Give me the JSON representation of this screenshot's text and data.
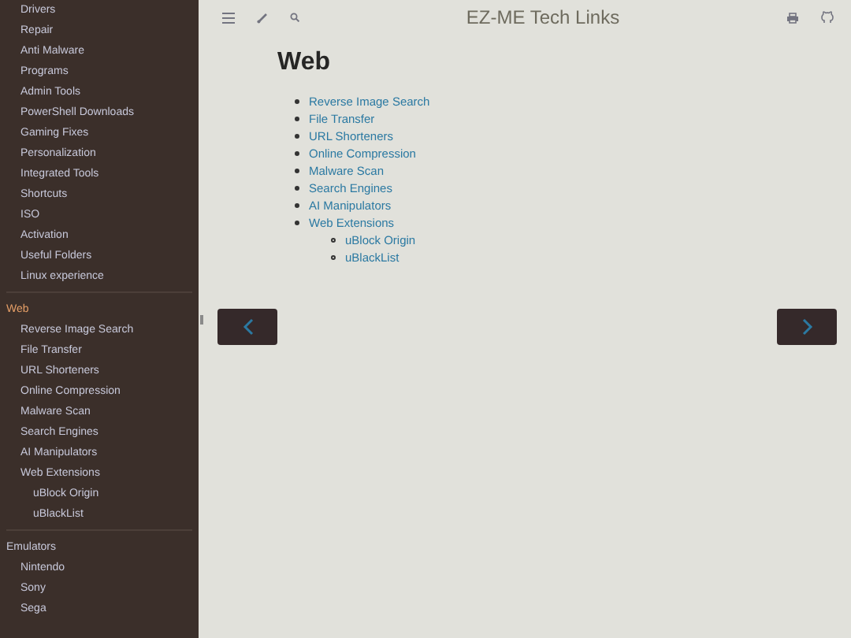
{
  "sidebar": {
    "sections": [
      {
        "items": [
          {
            "label": "Drivers",
            "selected": false
          },
          {
            "label": "Repair",
            "selected": false
          },
          {
            "label": "Anti Malware",
            "selected": false
          },
          {
            "label": "Programs",
            "selected": false
          },
          {
            "label": "Admin Tools",
            "selected": false
          },
          {
            "label": "PowerShell Downloads",
            "selected": false
          },
          {
            "label": "Gaming Fixes",
            "selected": false
          },
          {
            "label": "Personalization",
            "selected": false
          },
          {
            "label": "Integrated Tools",
            "selected": false
          },
          {
            "label": "Shortcuts",
            "selected": false
          },
          {
            "label": "ISO",
            "selected": false
          },
          {
            "label": "Activation",
            "selected": false
          },
          {
            "label": "Useful Folders",
            "selected": false
          },
          {
            "label": "Linux experience",
            "selected": false
          }
        ]
      },
      {
        "title": "Web",
        "selected": true,
        "items": [
          {
            "label": "Reverse Image Search",
            "selected": false
          },
          {
            "label": "File Transfer",
            "selected": false
          },
          {
            "label": "URL Shorteners",
            "selected": false
          },
          {
            "label": "Online Compression",
            "selected": false
          },
          {
            "label": "Malware Scan",
            "selected": false
          },
          {
            "label": "Search Engines",
            "selected": false
          },
          {
            "label": "AI Manipulators",
            "selected": false
          },
          {
            "label": "Web Extensions",
            "selected": false,
            "children": [
              {
                "label": "uBlock Origin",
                "selected": false
              },
              {
                "label": "uBlackList",
                "selected": false
              }
            ]
          }
        ]
      },
      {
        "title": "Emulators",
        "selected": false,
        "items": [
          {
            "label": "Nintendo",
            "selected": false
          },
          {
            "label": "Sony",
            "selected": false
          },
          {
            "label": "Sega",
            "selected": false
          }
        ]
      }
    ]
  },
  "toolbar": {
    "title": "EZ-ME Tech Links"
  },
  "content": {
    "heading": "Web",
    "links": [
      {
        "label": "Reverse Image Search"
      },
      {
        "label": "File Transfer"
      },
      {
        "label": "URL Shorteners"
      },
      {
        "label": "Online Compression"
      },
      {
        "label": "Malware Scan"
      },
      {
        "label": "Search Engines"
      },
      {
        "label": "AI Manipulators"
      },
      {
        "label": "Web Extensions",
        "children": [
          {
            "label": "uBlock Origin"
          },
          {
            "label": "uBlackList"
          }
        ]
      }
    ]
  }
}
